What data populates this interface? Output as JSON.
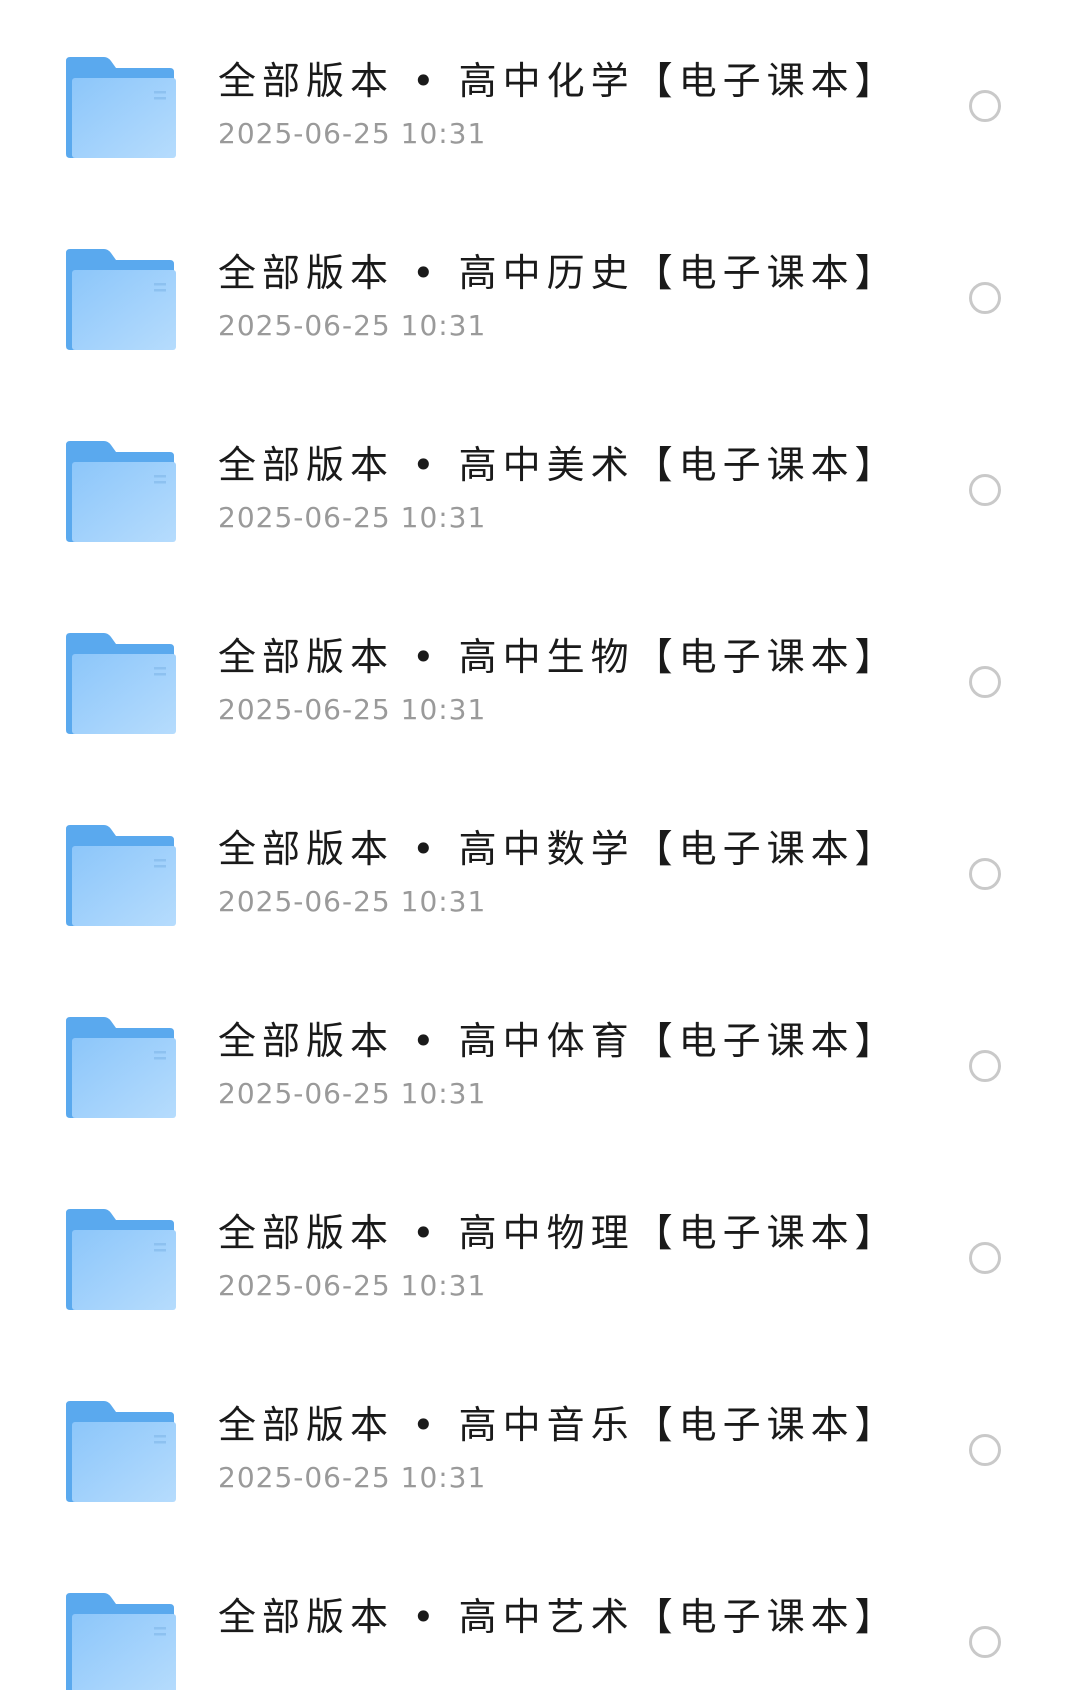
{
  "files": [
    {
      "name": "全部版本 • 高中化学【电子课本】",
      "date": "2025-06-25 10:31"
    },
    {
      "name": "全部版本 • 高中历史【电子课本】",
      "date": "2025-06-25 10:31"
    },
    {
      "name": "全部版本 • 高中美术【电子课本】",
      "date": "2025-06-25 10:31"
    },
    {
      "name": "全部版本 • 高中生物【电子课本】",
      "date": "2025-06-25 10:31"
    },
    {
      "name": "全部版本 • 高中数学【电子课本】",
      "date": "2025-06-25 10:31"
    },
    {
      "name": "全部版本 • 高中体育【电子课本】",
      "date": "2025-06-25 10:31"
    },
    {
      "name": "全部版本 • 高中物理【电子课本】",
      "date": "2025-06-25 10:31"
    },
    {
      "name": "全部版本 • 高中音乐【电子课本】",
      "date": "2025-06-25 10:31"
    },
    {
      "name": "全部版本 • 高中艺术【电子课本】",
      "date": ""
    }
  ],
  "icons": {
    "item_icon": "folder-icon",
    "select_icon": "radio-unchecked-icon"
  },
  "colors": {
    "folder_back": "#5aa9ee",
    "folder_front": "#9fd0fb",
    "date_text": "#9a9a9a",
    "radio_border": "#c9c9c9"
  }
}
